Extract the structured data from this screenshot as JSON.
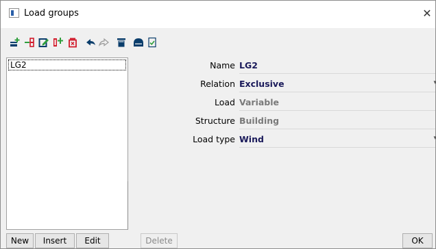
{
  "window": {
    "title": "Load groups",
    "close_glyph": "✕"
  },
  "toolbar": {
    "buttons": [
      {
        "icon": "new-record-icon"
      },
      {
        "icon": "insert-record-icon"
      },
      {
        "icon": "edit-record-icon"
      },
      {
        "icon": "copy-record-icon"
      },
      {
        "icon": "delete-record-icon"
      },
      {
        "icon": "undo-icon"
      },
      {
        "icon": "redo-icon"
      },
      {
        "icon": "clear-icon"
      },
      {
        "icon": "open-icon"
      },
      {
        "icon": "check-icon"
      }
    ]
  },
  "list": {
    "items": [
      "LG2"
    ]
  },
  "properties": [
    {
      "label": "Name",
      "value": "LG2",
      "style": "strong"
    },
    {
      "label": "Relation",
      "value": "Exclusive",
      "style": "strong",
      "dropdown": true
    },
    {
      "label": "Load",
      "value": "Variable",
      "style": "muted"
    },
    {
      "label": "Structure",
      "value": "Building",
      "style": "muted"
    },
    {
      "label": "Load type",
      "value": "Wind",
      "style": "strong",
      "dropdown": true
    }
  ],
  "dropdown_glyph": "▾",
  "buttons": {
    "new": "New",
    "insert": "Insert",
    "edit": "Edit",
    "delete": "Delete",
    "ok": "OK"
  },
  "colors": {
    "accent": "#1a1a5a",
    "muted": "#7a7a7a",
    "icon_red": "#d11a2a",
    "icon_blue": "#0a3d6b"
  }
}
